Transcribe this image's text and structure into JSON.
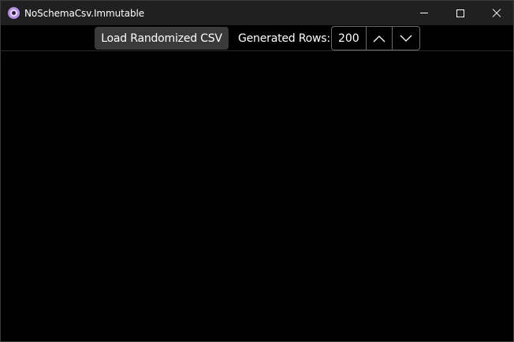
{
  "window": {
    "title": "NoSchemaCsv.Immutable",
    "icon": "app-icon",
    "controls": {
      "minimize": "minimize-icon",
      "maximize": "maximize-icon",
      "close": "close-icon"
    }
  },
  "toolbar": {
    "load_button_label": "Load Randomized CSV",
    "rows_label": "Generated Rows:",
    "rows_value": "200",
    "increment_icon": "chevron-up-icon",
    "decrement_icon": "chevron-down-icon"
  },
  "colors": {
    "titlebar_bg": "#202020",
    "content_bg": "#000000",
    "button_bg": "#3a3a3a",
    "stepper_border": "#6a6a6a",
    "app_icon_accent": "#b48ee8"
  }
}
